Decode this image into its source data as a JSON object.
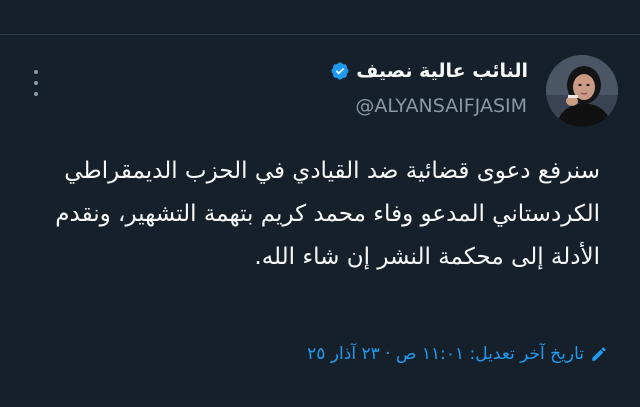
{
  "tweet": {
    "author": {
      "display_name": "النائب عالية نصيف",
      "handle": "@ALYANSAIFJASIM",
      "verified": true,
      "verified_color": "#1d9bf0"
    },
    "text": "سنرفع دعوى قضائية ضد القيادي في الحزب الديمقراطي الكردستاني المدعو وفاء محمد كريم بتهمة التشهير، ونقدم الأدلة إلى محكمة النشر إن شاء الله.",
    "edited_label": "تاريخ آخر تعديل: ١١:٠١ ص · ٢٣ آذار ٢٥"
  },
  "icons": {
    "more": "more-vertical-icon",
    "verified": "verified-badge-icon",
    "edit": "pencil-edit-icon"
  },
  "colors": {
    "background": "#15202b",
    "text_primary": "#f7f9f9",
    "text_secondary": "#8b98a5",
    "accent": "#1d9bf0"
  }
}
